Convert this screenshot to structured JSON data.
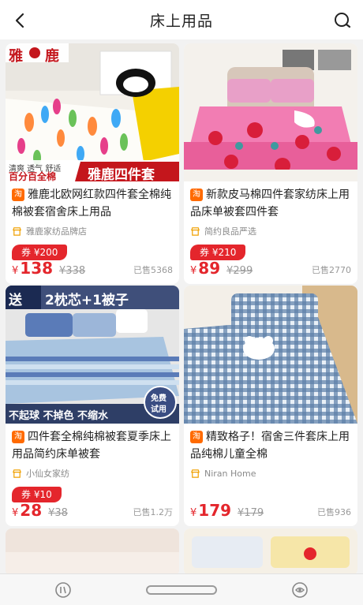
{
  "header": {
    "title": "床上用品",
    "back_icon": "back-arrow-icon",
    "search_icon": "search-icon"
  },
  "products": [
    {
      "title": "雅鹿北欧网红款四件套全棉纯棉被套宿舍床上用品",
      "platform_badge": "淘",
      "shop": "雅鹿家纺品牌店",
      "coupon": "券 ¥200",
      "currency": "¥",
      "price": "138",
      "original_price": "¥338",
      "sold": "已售5368",
      "image_texts": {
        "brand": "雅",
        "brand2": "鹿",
        "line1": "清爽 透气 舒适",
        "line2": "百分百全棉",
        "banner": "雅鹿四件套"
      }
    },
    {
      "title": "新款皮马棉四件套家纺床上用品床单被套四件套",
      "platform_badge": "淘",
      "shop": "简约良品严选",
      "coupon": "券 ¥210",
      "currency": "¥",
      "price": "89",
      "original_price": "¥299",
      "sold": "已售2770",
      "image_texts": {}
    },
    {
      "title": "四件套全棉纯棉被套夏季床上用品简约床单被套",
      "platform_badge": "淘",
      "shop": "小仙女家纺",
      "coupon": "券 ¥10",
      "currency": "¥",
      "price": "28",
      "original_price": "¥38",
      "sold": "已售1.2万",
      "image_texts": {
        "top_left": "送",
        "top": "2枕芯+1被子",
        "bottom": "不起球 不掉色 不缩水",
        "trial": "免费",
        "trial2": "试用"
      }
    },
    {
      "title": "精致格子！宿舍三件套床上用品纯棉儿童全棉",
      "platform_badge": "淘",
      "shop": "Niran Home",
      "coupon": "",
      "currency": "¥",
      "price": "179",
      "original_price": "¥179",
      "sold": "已售936",
      "image_texts": {}
    }
  ],
  "bottom_nav": {
    "left_icon": "recent-apps-icon",
    "center_icon": "home-pill",
    "right_icon": "back-gesture-icon"
  },
  "colors": {
    "accent_red": "#e4262c",
    "taobao_orange": "#ff6a00"
  }
}
